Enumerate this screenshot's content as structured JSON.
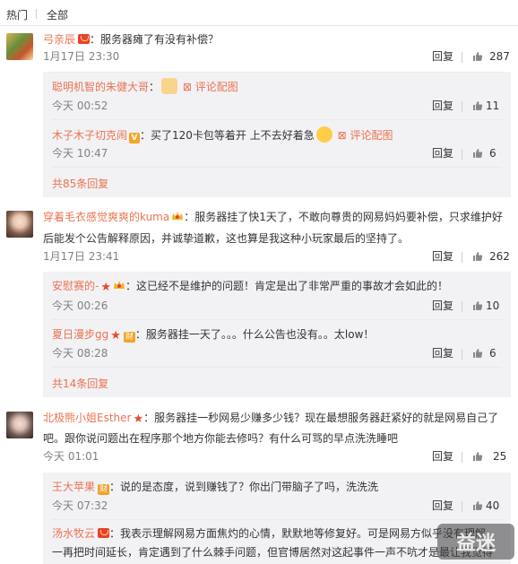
{
  "tabs": {
    "hot": "热门",
    "all": "全部"
  },
  "comments": [
    {
      "name": "弓亲辰",
      "text": "：服务器瘫了有没有补偿？",
      "time": "1月17日 23:30",
      "reply": "回复",
      "likes": "287",
      "replies": [
        {
          "name": "聪明机智的朱健大哥",
          "text": "：",
          "link": "评论配图",
          "time": "今天 00:52",
          "reply": "回复",
          "likes": "11"
        },
        {
          "name": "木子木子切克闹",
          "text": "：买了120卡包等着开 上不去好着急",
          "link": "评论配图",
          "time": "今天 10:47",
          "reply": "回复",
          "likes": "6"
        }
      ],
      "more": "共85条回复"
    },
    {
      "name": "穿着毛衣感觉爽爽的kuma",
      "text": "：服务器挂了快1天了，不敢向尊贵的网易妈妈要补偿，只求维护好",
      "text2": "后能发个公告解释原因，并诚挚道歉，这也算是我这种小玩家最后的坚持了。",
      "time": "1月17日 23:41",
      "reply": "回复",
      "likes": "262",
      "replies": [
        {
          "name": "安慰赛的-",
          "text": "：这已经不是维护的问题！肯定是出了非常严重的事故才会如此的！",
          "time": "今天 00:26",
          "reply": "回复",
          "likes": "10"
        },
        {
          "name": "夏日漫步gg",
          "text": "：服务器挂一天了。。。什么公告也没有。。太low！",
          "time": "今天 08:28",
          "reply": "回复",
          "likes": "6"
        }
      ],
      "more": "共14条回复"
    },
    {
      "name": "北极熊小姐Esther",
      "text": "：服务器挂一秒网易少赚多少钱？现在最想服务器赶紧好的就是网易自己了",
      "text2": "吧。跟你说问题出在程序那个地方你能去修吗？有什么可骂的早点洗洗睡吧",
      "time": "今天 01:01",
      "reply": "回复",
      "likes": "25",
      "replies": [
        {
          "name": "王大苹果",
          "text": "：说的是态度，说到赚钱了？你出门带脑子了吗，洗洗洗",
          "time": "今天 07:32",
          "reply": "回复",
          "likes": "40"
        },
        {
          "name": "汤水牧云",
          "text": "：我表示理解网易方面焦灼的心情，默默地等修复好。可是网易方似乎没有理解",
          "text2": "一再把时间延长，肯定遇到了什么棘手问题，但官博居然对这起事件一声不吭才是最让我觉得"
        }
      ]
    }
  ],
  "badge_labels": {
    "vip": "V",
    "cai": "财"
  },
  "watermark": "益迷",
  "colors": {
    "name": "#eb7350",
    "text": "#333333",
    "meta": "#808080",
    "reply_bg": "#f2f2f5"
  }
}
